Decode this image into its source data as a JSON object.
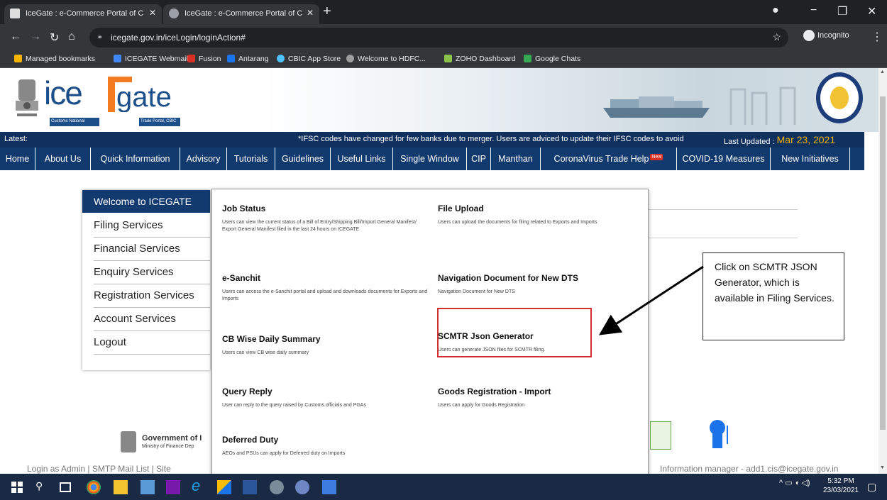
{
  "browser": {
    "tabs": [
      {
        "title": "IceGate : e-Commerce Portal of C"
      },
      {
        "title": "IceGate : e-Commerce Portal of C"
      }
    ],
    "new_tab_symbol": "+",
    "url": "icegate.gov.in/iceLogin/loginAction#",
    "profile_label": "Incognito",
    "bookmarks": [
      {
        "label": "Managed bookmarks",
        "color": "#f4b400"
      },
      {
        "label": "ICEGATE Webmail",
        "color": "#4285f4"
      },
      {
        "label": "Fusion",
        "color": "#d93025"
      },
      {
        "label": "Antarang",
        "color": "#1a73e8"
      },
      {
        "label": "CBIC App Store",
        "color": "#4fc3f7"
      },
      {
        "label": "Welcome to HDFC...",
        "color": "#9e9e9e"
      },
      {
        "label": "ZOHO Dashboard",
        "color": "#8bc34a"
      },
      {
        "label": "Google Chats",
        "color": "#34a853"
      }
    ]
  },
  "site": {
    "logo_ice": "ice",
    "logo_gate": "gate",
    "logo_sub_left": "Customs National",
    "logo_sub_right": "Trade Portal, CBIC",
    "ticker_label": "Latest:",
    "ticker_message": "*IFSC codes have changed for few banks due to merger. Users are adviced to update their IFSC codes to avoid",
    "last_updated_label": "Last Updated :",
    "last_updated_value": "Mar 23, 2021",
    "nav": [
      {
        "label": "Home"
      },
      {
        "label": "About Us"
      },
      {
        "label": "Quick Information"
      },
      {
        "label": "Advisory"
      },
      {
        "label": "Tutorials"
      },
      {
        "label": "Guidelines"
      },
      {
        "label": "Useful Links"
      },
      {
        "label": "Single Window"
      },
      {
        "label": "CIP"
      },
      {
        "label": "Manthan"
      },
      {
        "label": "CoronaVirus Trade Help"
      },
      {
        "label": "COVID-19 Measures"
      },
      {
        "label": "New Initiatives"
      }
    ],
    "new_badge": "New"
  },
  "left_menu": {
    "header": "Welcome to ICEGATE",
    "items": [
      {
        "label": "Filing Services"
      },
      {
        "label": "Financial Services"
      },
      {
        "label": "Enquiry Services"
      },
      {
        "label": "Registration Services"
      },
      {
        "label": "Account Services"
      },
      {
        "label": "Logout"
      }
    ]
  },
  "dropdown": {
    "items": [
      {
        "title": "Job Status",
        "desc": "Users can view the current status of a Bill of Entry/Shipping Bill/Import General Manifest/ Export General Manifest filed in the last 24 hours on ICEGATE"
      },
      {
        "title": "File Upload",
        "desc": "Users can upload the documents for filing related to Exports and Imports"
      },
      {
        "title": "e-Sanchit",
        "desc": "Users can access the e-Sanchit portal and upload and downloads documents for Exports and Imports"
      },
      {
        "title": "Navigation Document for New DTS",
        "desc": "Navigation Document for New DTS"
      },
      {
        "title": "CB Wise Daily Summary",
        "desc": "Users can view CB wise daily summary"
      },
      {
        "title": "SCMTR Json Generator",
        "desc": "Users can generate JSON files for SCMTR filing."
      },
      {
        "title": "Query Reply",
        "desc": "User can reply to the query raised by Customs officials and PGAs"
      },
      {
        "title": "Goods Registration - Import",
        "desc": "Users can apply for Goods Registration"
      },
      {
        "title": "Deferred Duty",
        "desc": "AEOs and PSUs can apply for Deferred duty on Imports"
      }
    ]
  },
  "annotation": {
    "text": "Click on SCMTR JSON Generator, which is available in Filing Services."
  },
  "footer": {
    "gov_name": "Government of I",
    "gov_sub": "Ministry of Finance Dep",
    "links_text": "Login as Admin  |  SMTP Mail List  |  Site",
    "contact_text": "Information manager - add1.cis@icegate.gov.in"
  },
  "taskbar": {
    "time": "5:32 PM",
    "date": "23/03/2021"
  }
}
